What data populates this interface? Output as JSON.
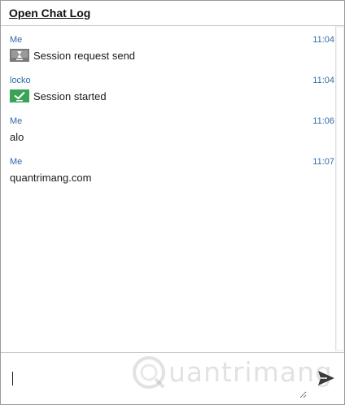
{
  "header": {
    "link_label": "Open Chat Log"
  },
  "messages": [
    {
      "sender": "Me",
      "time": "11:04",
      "text": "Session request send",
      "icon": "session-request-icon",
      "icon_color": "#7a7a7a"
    },
    {
      "sender": "locko",
      "time": "11:04",
      "text": "Session started",
      "icon": "session-started-icon",
      "icon_color": "#3aa357"
    },
    {
      "sender": "Me",
      "time": "11:06",
      "text": "alo",
      "icon": null
    },
    {
      "sender": "Me",
      "time": "11:07",
      "text": "quantrimang.com",
      "icon": null
    }
  ],
  "composer": {
    "value": "",
    "placeholder": "",
    "send_icon": "send-icon"
  },
  "watermark": {
    "text": "uantrimang"
  },
  "colors": {
    "sender_blue": "#2f6aa8",
    "border": "#c8c8c8",
    "session_started_green": "#3aa357",
    "session_request_gray": "#7a7a7a"
  }
}
